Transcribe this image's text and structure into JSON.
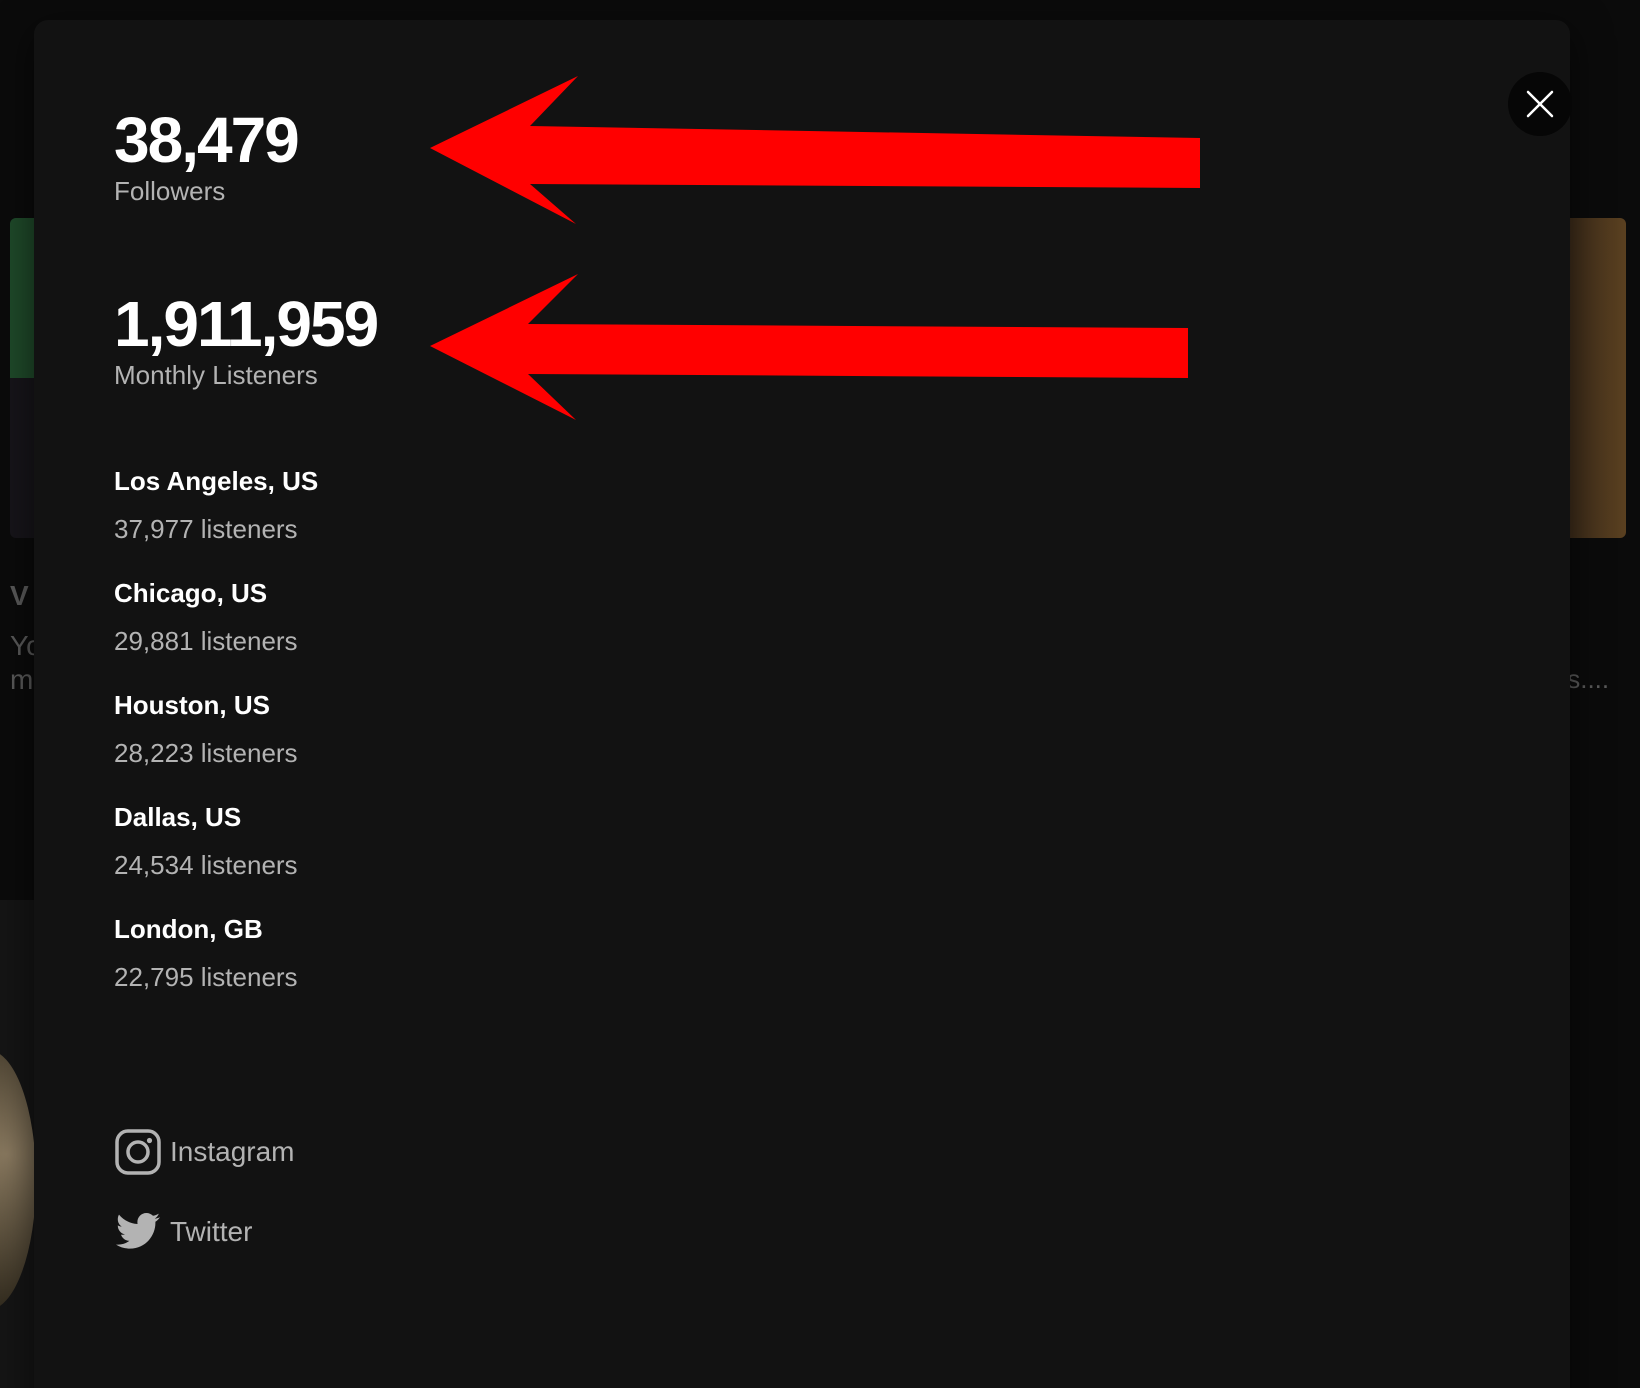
{
  "stats": {
    "followers_value": "38,479",
    "followers_label": "Followers",
    "monthly_listeners_value": "1,911,959",
    "monthly_listeners_label": "Monthly Listeners"
  },
  "cities": [
    {
      "name": "Los Angeles, US",
      "listeners": "37,977 listeners"
    },
    {
      "name": "Chicago, US",
      "listeners": "29,881 listeners"
    },
    {
      "name": "Houston, US",
      "listeners": "28,223 listeners"
    },
    {
      "name": "Dallas, US",
      "listeners": "24,534 listeners"
    },
    {
      "name": "London, GB",
      "listeners": "22,795 listeners"
    }
  ],
  "social": {
    "instagram_label": "Instagram",
    "twitter_label": "Twitter"
  },
  "background": {
    "left_text_1": "V",
    "left_text_2": "Yo",
    "left_text_3": "m",
    "right_text": "ıs...."
  },
  "icons": {
    "close": "close-icon",
    "instagram": "instagram-icon",
    "twitter": "twitter-icon",
    "arrow": "red-arrow-left-icon"
  },
  "colors": {
    "modal_bg": "#121212",
    "primary_text": "#ffffff",
    "secondary_text": "#b3b3b3",
    "annotation_arrow": "#ff0000"
  }
}
